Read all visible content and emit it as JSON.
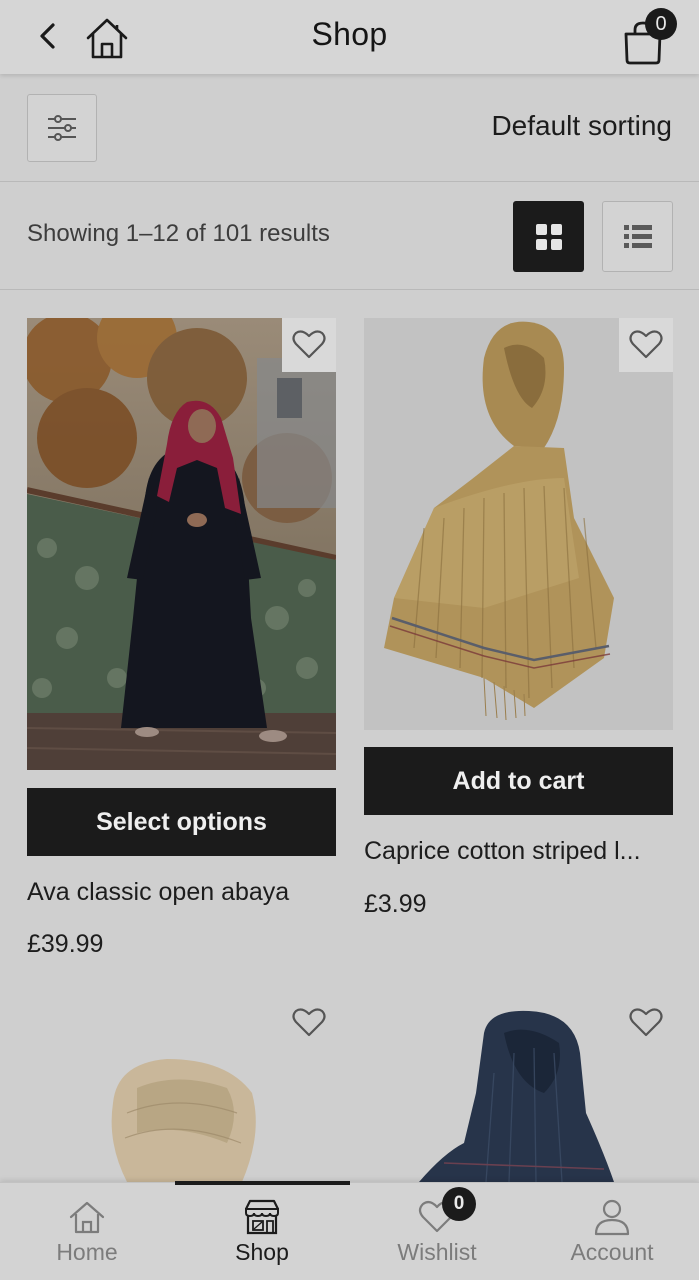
{
  "header": {
    "title": "Shop",
    "back_icon": "chevron-left-icon",
    "home_icon": "home-icon",
    "cart_icon": "shopping-bag-icon",
    "cart_count": "0"
  },
  "toolbar": {
    "filter_icon": "sliders-icon",
    "sorting_label": "Default sorting"
  },
  "results": {
    "text": "Showing 1–12 of 101 results",
    "grid_view_icon": "grid-view-icon",
    "list_view_icon": "list-view-icon",
    "active_view": "grid"
  },
  "products": [
    {
      "name": "Ava classic open abaya",
      "price": "£39.99",
      "action": "Select options"
    },
    {
      "name": "Caprice cotton striped l...",
      "price": "£3.99",
      "action": "Add to cart"
    }
  ],
  "bottom_nav": {
    "items": [
      {
        "label": "Home",
        "icon": "home-icon"
      },
      {
        "label": "Shop",
        "icon": "store-icon"
      },
      {
        "label": "Wishlist",
        "icon": "heart-icon",
        "badge": "0"
      },
      {
        "label": "Account",
        "icon": "user-icon"
      }
    ],
    "active": "Shop"
  },
  "colors": {
    "background": "#cfcfcf",
    "primary_button": "#1b1b1b",
    "button_text": "#efefef",
    "muted_nav": "#7c7c7c"
  }
}
